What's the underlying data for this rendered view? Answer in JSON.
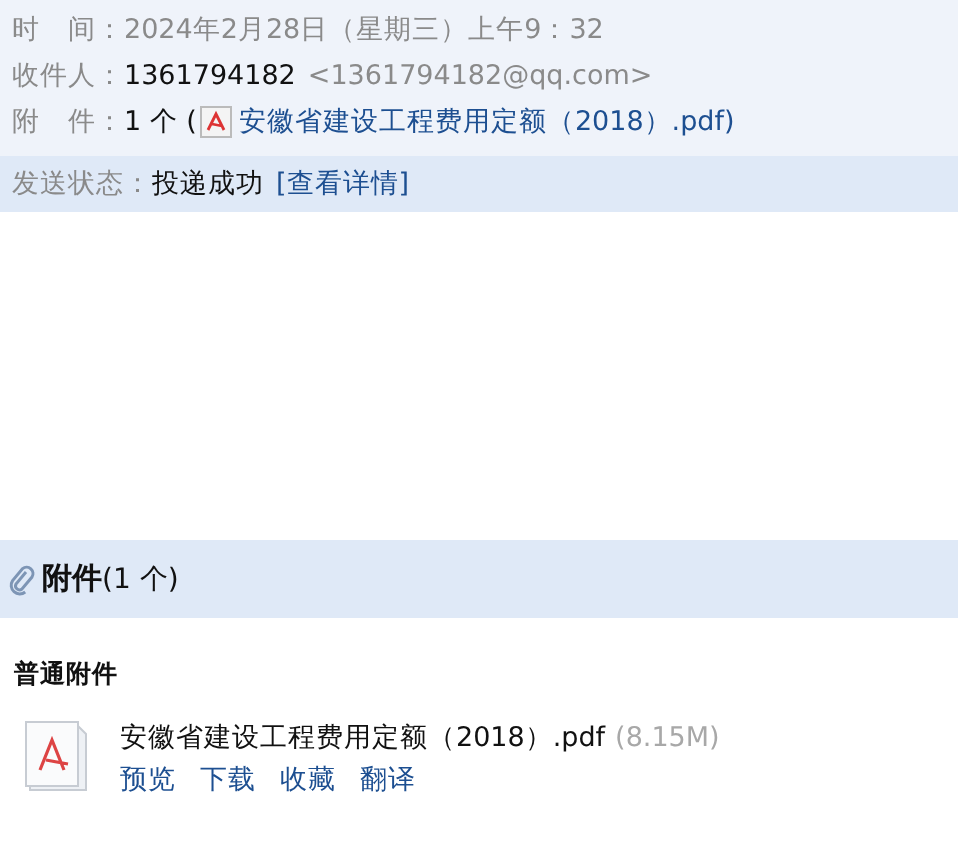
{
  "header": {
    "fields": [
      {
        "kind": "time",
        "label": "时　间：",
        "value": "2024年2月28日（星期三）上午9：32"
      },
      {
        "kind": "recipient",
        "label": "收件人：",
        "name": "1361794182",
        "address": "<1361794182@qq.com>"
      },
      {
        "kind": "attachment",
        "label": "附　件：",
        "count": "1 个 (",
        "file": "安徽省建设工程费用定额（2018）.pdf",
        "close": ")"
      }
    ]
  },
  "status": {
    "label": "发送状态：",
    "value": "投递成功",
    "link": "[查看详情]"
  },
  "attachments": {
    "title": "附件",
    "count": "(1 个)",
    "section": "普通附件",
    "files": [
      {
        "name": "安徽省建设工程费用定额（2018）.pdf",
        "size": "(8.15M)",
        "actions": [
          "预览",
          "下载",
          "收藏",
          "翻译"
        ]
      }
    ]
  }
}
